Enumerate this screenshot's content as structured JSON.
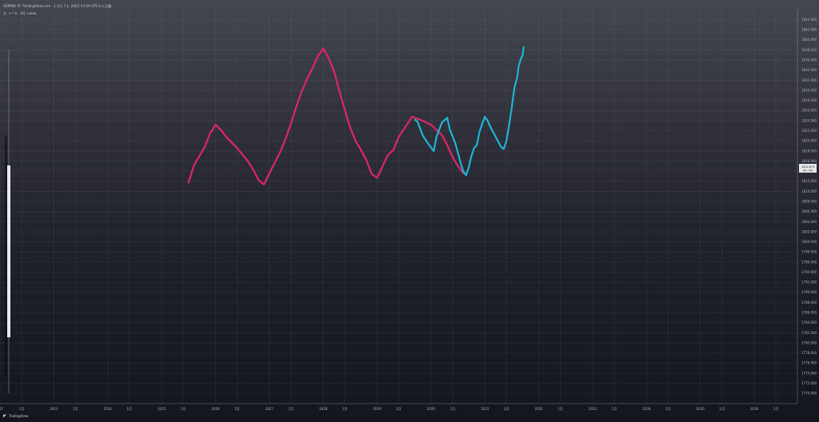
{
  "header": {
    "title": "GEMINI: FF TradingView.com · 1·3万 7·1, 2022 13:59 UTC十二三國",
    "subtitle": "五 · 0 7 8 · 1时, 1488A"
  },
  "price_tag": {
    "price": "1822.875",
    "sub": "00 / 00"
  },
  "footer": {
    "logo_text": "TradingView"
  },
  "colors": {
    "series_pink": "#e0256a",
    "series_blue": "#1fb4d6"
  },
  "chart_data": {
    "type": "line",
    "title": "",
    "xlabel": "",
    "ylabel": "",
    "xlim": [
      2022,
      2036.8
    ],
    "ylim": [
      1768,
      1846
    ],
    "x_ticks": [
      {
        "x": 2022.0,
        "label": "022"
      },
      {
        "x": 2022.4,
        "label": "1月"
      },
      {
        "x": 2023.0,
        "label": "2023"
      },
      {
        "x": 2023.4,
        "label": "1月"
      },
      {
        "x": 2024.0,
        "label": "2024"
      },
      {
        "x": 2024.4,
        "label": "1月"
      },
      {
        "x": 2025.0,
        "label": "2025"
      },
      {
        "x": 2025.4,
        "label": "1月"
      },
      {
        "x": 2026.0,
        "label": "2026"
      },
      {
        "x": 2026.4,
        "label": "1月"
      },
      {
        "x": 2027.0,
        "label": "2027"
      },
      {
        "x": 2027.4,
        "label": "1月"
      },
      {
        "x": 2028.0,
        "label": "2028"
      },
      {
        "x": 2028.4,
        "label": "1月"
      },
      {
        "x": 2029.0,
        "label": "2029"
      },
      {
        "x": 2029.4,
        "label": "1月"
      },
      {
        "x": 2030.0,
        "label": "2030"
      },
      {
        "x": 2030.4,
        "label": "1月"
      },
      {
        "x": 2031.0,
        "label": "2031"
      },
      {
        "x": 2031.4,
        "label": "1月"
      },
      {
        "x": 2032.0,
        "label": "2032"
      },
      {
        "x": 2032.4,
        "label": "1月"
      },
      {
        "x": 2033.0,
        "label": "2033"
      },
      {
        "x": 2033.4,
        "label": "1月"
      },
      {
        "x": 2034.0,
        "label": "2034"
      },
      {
        "x": 2034.4,
        "label": "1月"
      },
      {
        "x": 2035.0,
        "label": "2035"
      },
      {
        "x": 2035.4,
        "label": "1月"
      },
      {
        "x": 2036.0,
        "label": "2036"
      },
      {
        "x": 2036.4,
        "label": "1月"
      }
    ],
    "y_ticks": [
      {
        "y": 1844,
        "label": "1844.000"
      },
      {
        "y": 1842,
        "label": "1842.000"
      },
      {
        "y": 1840,
        "label": "1840.000"
      },
      {
        "y": 1838,
        "label": "1838.000"
      },
      {
        "y": 1836,
        "label": "1836.000"
      },
      {
        "y": 1834,
        "label": "1834.000"
      },
      {
        "y": 1832,
        "label": "1832.000"
      },
      {
        "y": 1830,
        "label": "1830.000"
      },
      {
        "y": 1828,
        "label": "1828.000"
      },
      {
        "y": 1826,
        "label": "1826.000"
      },
      {
        "y": 1824,
        "label": "1824.000"
      },
      {
        "y": 1822,
        "label": "1822.000"
      },
      {
        "y": 1820,
        "label": "1820.000"
      },
      {
        "y": 1818,
        "label": "1818.000"
      },
      {
        "y": 1816,
        "label": "1816.000"
      },
      {
        "y": 1814,
        "label": "1814.000"
      },
      {
        "y": 1812,
        "label": "1812.000"
      },
      {
        "y": 1810,
        "label": "1810.000"
      },
      {
        "y": 1808,
        "label": "1808.000"
      },
      {
        "y": 1806,
        "label": "1806.000"
      },
      {
        "y": 1804,
        "label": "1804.000"
      },
      {
        "y": 1802,
        "label": "1802.000"
      },
      {
        "y": 1800,
        "label": "1800.000"
      },
      {
        "y": 1798,
        "label": "1798.000"
      },
      {
        "y": 1796,
        "label": "1796.000"
      },
      {
        "y": 1794,
        "label": "1794.000"
      },
      {
        "y": 1792,
        "label": "1792.000"
      },
      {
        "y": 1790,
        "label": "1790.000"
      },
      {
        "y": 1788,
        "label": "1788.000"
      },
      {
        "y": 1786,
        "label": "1786.000"
      },
      {
        "y": 1784,
        "label": "1784.000"
      },
      {
        "y": 1782,
        "label": "1782.000"
      },
      {
        "y": 1780,
        "label": "1780.000"
      },
      {
        "y": 1778,
        "label": "1778.000"
      },
      {
        "y": 1776,
        "label": "1776.000"
      },
      {
        "y": 1774,
        "label": "1774.000"
      },
      {
        "y": 1772,
        "label": "1772.000"
      },
      {
        "y": 1770,
        "label": "1770.000"
      }
    ],
    "grid": true,
    "series": [
      {
        "color": "#e0256a",
        "points": [
          [
            2025.5,
            1811.8
          ],
          [
            2025.6,
            1815.2
          ],
          [
            2025.7,
            1817.0
          ],
          [
            2025.8,
            1818.8
          ],
          [
            2025.9,
            1821.5
          ],
          [
            2026.0,
            1823.2
          ],
          [
            2026.1,
            1822.2
          ],
          [
            2026.2,
            1820.8
          ],
          [
            2026.4,
            1818.6
          ],
          [
            2026.6,
            1816.0
          ],
          [
            2026.7,
            1814.3
          ],
          [
            2026.8,
            1812.2
          ],
          [
            2026.9,
            1811.4
          ],
          [
            2027.0,
            1813.6
          ],
          [
            2027.2,
            1817.8
          ],
          [
            2027.3,
            1820.4
          ],
          [
            2027.4,
            1823.4
          ],
          [
            2027.5,
            1826.8
          ],
          [
            2027.6,
            1829.8
          ],
          [
            2027.7,
            1832.3
          ],
          [
            2027.8,
            1834.4
          ],
          [
            2027.9,
            1836.8
          ],
          [
            2028.0,
            1838.3
          ],
          [
            2028.1,
            1836.4
          ],
          [
            2028.2,
            1833.8
          ],
          [
            2028.3,
            1829.8
          ],
          [
            2028.4,
            1826.2
          ],
          [
            2028.5,
            1822.6
          ],
          [
            2028.6,
            1820.0
          ],
          [
            2028.7,
            1818.2
          ],
          [
            2028.8,
            1816.2
          ],
          [
            2028.9,
            1813.4
          ],
          [
            2029.0,
            1812.7
          ],
          [
            2029.1,
            1815.0
          ],
          [
            2029.2,
            1817.2
          ],
          [
            2029.3,
            1818.2
          ],
          [
            2029.4,
            1820.8
          ],
          [
            2029.5,
            1822.4
          ],
          [
            2029.65,
            1824.8
          ],
          [
            2029.8,
            1824.2
          ],
          [
            2030.0,
            1823.2
          ],
          [
            2030.2,
            1821.2
          ],
          [
            2030.3,
            1819.2
          ],
          [
            2030.4,
            1816.8
          ],
          [
            2030.5,
            1815.0
          ],
          [
            2030.6,
            1813.6
          ]
        ]
      },
      {
        "color": "#1fb4d6",
        "points": [
          [
            2029.7,
            1824.2
          ],
          [
            2029.75,
            1823.8
          ],
          [
            2029.8,
            1822.4
          ],
          [
            2029.85,
            1821.0
          ],
          [
            2029.95,
            1819.4
          ],
          [
            2030.05,
            1818.0
          ],
          [
            2030.1,
            1820.8
          ],
          [
            2030.2,
            1823.6
          ],
          [
            2030.3,
            1824.6
          ],
          [
            2030.35,
            1822.2
          ],
          [
            2030.45,
            1819.6
          ],
          [
            2030.5,
            1817.6
          ],
          [
            2030.55,
            1815.6
          ],
          [
            2030.6,
            1814.0
          ],
          [
            2030.65,
            1813.2
          ],
          [
            2030.7,
            1814.8
          ],
          [
            2030.75,
            1817.0
          ],
          [
            2030.8,
            1818.6
          ],
          [
            2030.85,
            1819.2
          ],
          [
            2030.9,
            1821.8
          ],
          [
            2030.95,
            1823.4
          ],
          [
            2031.0,
            1824.8
          ],
          [
            2031.05,
            1824.0
          ],
          [
            2031.1,
            1822.8
          ],
          [
            2031.2,
            1820.8
          ],
          [
            2031.3,
            1818.8
          ],
          [
            2031.35,
            1818.4
          ],
          [
            2031.4,
            1820.0
          ],
          [
            2031.45,
            1823.2
          ],
          [
            2031.5,
            1826.8
          ],
          [
            2031.55,
            1830.6
          ],
          [
            2031.6,
            1832.6
          ],
          [
            2031.62,
            1834.4
          ],
          [
            2031.66,
            1836.0
          ],
          [
            2031.7,
            1837.0
          ],
          [
            2031.72,
            1838.6
          ]
        ]
      }
    ]
  }
}
